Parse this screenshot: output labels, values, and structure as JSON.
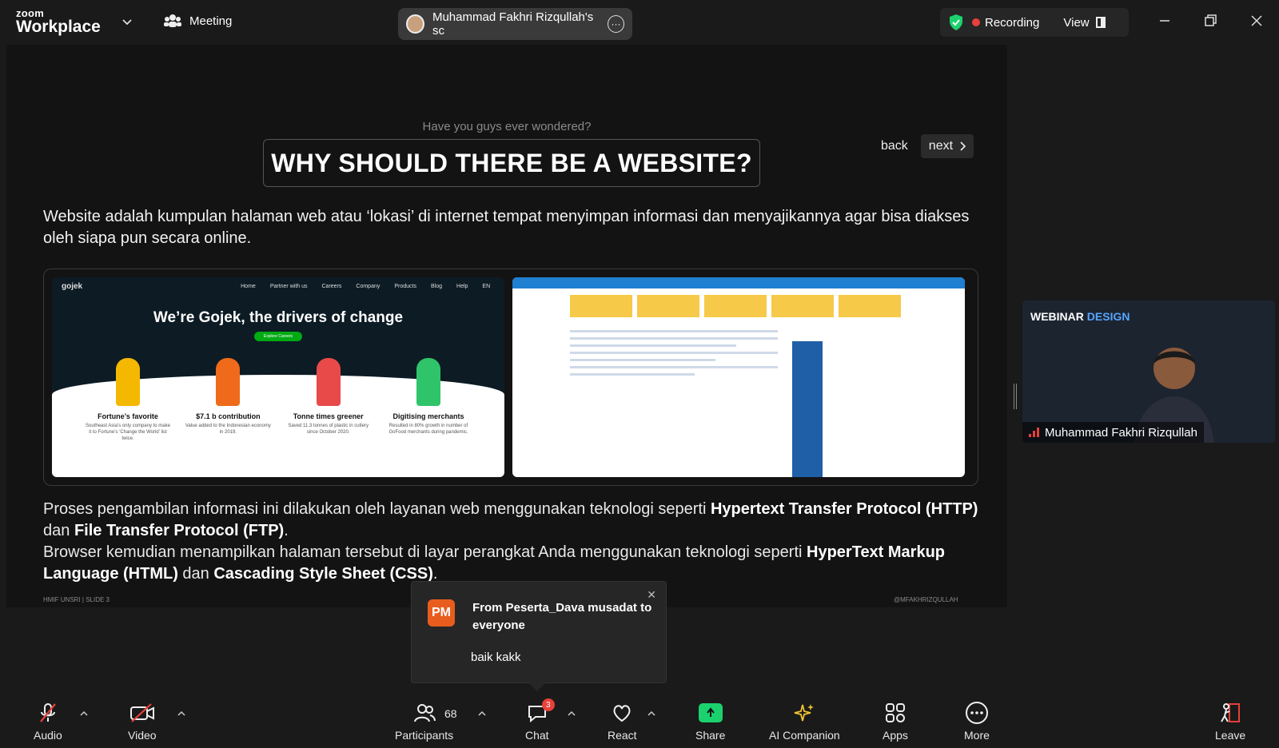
{
  "topbar": {
    "brand_small": "zoom",
    "brand_big": "Workplace",
    "meeting_label": "Meeting",
    "sharing_label": "Muhammad Fakhri Rizqullah's sc",
    "recording_label": "Recording",
    "view_label": "View"
  },
  "slide": {
    "subtitle": "Have you guys ever wondered?",
    "title": "WHY SHOULD THERE BE A WEBSITE?",
    "back_label": "back",
    "next_label": "next",
    "para1": "Website adalah kumpulan halaman web atau ‘lokasi’ di internet tempat  menyimpan informasi dan menyajikannya agar bisa diakses oleh siapa pun secara online.",
    "gojek": {
      "logo": "gojek",
      "nav": [
        "Home",
        "Partner with us",
        "Careers",
        "Company",
        "Products",
        "Blog",
        "Help",
        "EN"
      ],
      "hero": "We’re Gojek, the drivers of change",
      "cta": "Explore Careers",
      "cols": [
        {
          "h": "Fortune’s favorite",
          "d": "Southeast Asia’s only company to make it to Fortune’s ‘Change the World’ list twice.",
          "color": "#f5b800"
        },
        {
          "h": "$7.1 b contribution",
          "d": "Value added to the Indonesian economy in 2019.",
          "color": "#ef6a1a"
        },
        {
          "h": "Tonne times greener",
          "d": "Saved 11.3 tonnes of plastic in cutlery since October 2020.",
          "color": "#e84a4a"
        },
        {
          "h": "Digitising merchants",
          "d": "Resulted in 80% growth in number of GoFood merchants during pandemic.",
          "color": "#2fc46a"
        }
      ]
    },
    "para2_a": "Proses pengambilan informasi ini dilakukan oleh layanan web menggunakan teknologi seperti ",
    "para2_b": "Hypertext Transfer Protocol (HTTP)",
    "para2_c": " dan ",
    "para2_d": "File Transfer Protocol (FTP)",
    "para2_e": ".",
    "para3_a": "Browser kemudian menampilkan halaman tersebut di layar perangkat Anda menggunakan teknologi seperti ",
    "para3_b": "HyperText Markup Language (HTML)",
    "para3_c": " dan ",
    "para3_d": "Cascading Style Sheet (CSS)",
    "para3_e": ".",
    "footer_left": "HMIF UNSRI | SLIDE 3",
    "footer_right": "@MFAKHRIZQULLAH"
  },
  "video": {
    "banner_a": "WEBINAR ",
    "banner_b": "DESIGN",
    "name": "Muhammad Fakhri Rizqullah"
  },
  "toast": {
    "initials": "PM",
    "from": "From Peserta_Dava musadat to everyone",
    "message": "baik kakk"
  },
  "toolbar": {
    "audio": "Audio",
    "video": "Video",
    "participants": "Participants",
    "participant_count": "68",
    "chat": "Chat",
    "chat_badge": "3",
    "react": "React",
    "share": "Share",
    "ai": "AI Companion",
    "apps": "Apps",
    "more": "More",
    "leave": "Leave"
  },
  "colors": {
    "accent_green": "#1bd16d",
    "record_red": "#e8403a",
    "avatar_orange": "#e85d1e"
  }
}
